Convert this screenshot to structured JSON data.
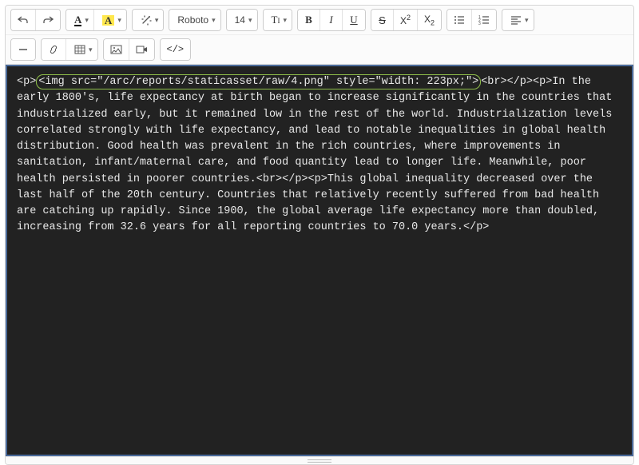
{
  "toolbar": {
    "font_family": "Roboto",
    "font_size": "14",
    "bold_label": "B",
    "italic_label": "I",
    "underline_label": "U",
    "strike_label": "S",
    "superscript_label": "X",
    "subscript_label": "X",
    "code_view_label": "</>"
  },
  "code": {
    "prefix": "<p>",
    "highlighted": "<img src=\"/arc/reports/staticasset/raw/4.png\" style=\"width: 223px;\">",
    "rest": "<br></p><p>In the early 1800's, life expectancy at birth began to increase significantly in the countries that industrialized early, but it remained low in the rest of the world. Industrialization levels correlated strongly with life expectancy, and lead to notable inequalities in global health distribution. Good health was prevalent in the rich countries, where improvements in sanitation, infant/maternal care, and food quantity lead to longer life. Meanwhile, poor health persisted in poorer countries.<br></p><p>This global inequality decreased over the last half of the 20th century. Countries that relatively recently suffered from bad health are catching up rapidly. Since 1900, the global average life expectancy more than doubled, increasing from 32.6 years for all reporting countries to 70.0 years.</p>"
  }
}
